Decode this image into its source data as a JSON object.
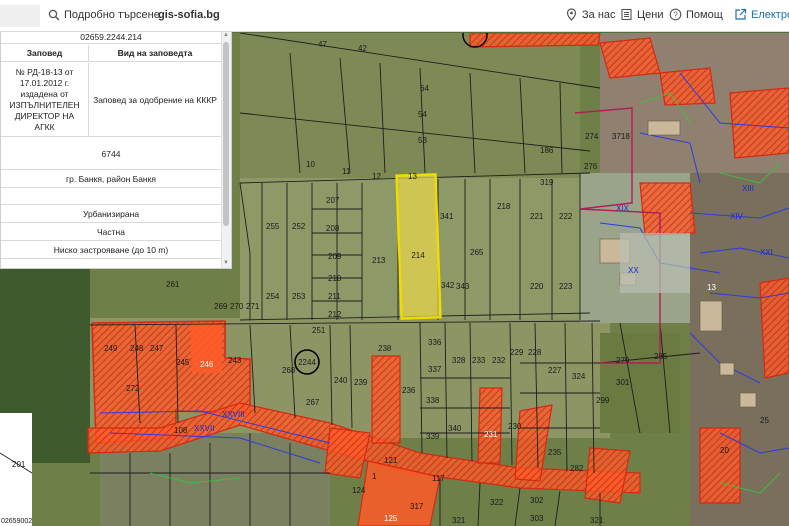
{
  "topbar": {
    "detailed_search": "Подробно търсене",
    "site_name": "gis-sofia.bg",
    "about": "За нас",
    "prices": "Цени",
    "help": "Помощ",
    "electronic": "Електрон"
  },
  "panel": {
    "parcel_id": "02659.2244.214",
    "col_order": "Заповед",
    "col_order_type": "Вид на заповедта",
    "order_text": "№ РД-18-13 от 17.01.2012 г. издадена от ИЗПЪЛНИТЕЛЕН ДИРЕКТОР НА АГКК",
    "order_type_text": "Заповед за одобрение на КККР",
    "area": "6744",
    "location": "гр. Банкя, район Банкя",
    "territory": "Урбанизирана",
    "ownership": "Частна",
    "usage": "Ниско застрояване (до 10 m)"
  },
  "map": {
    "selected_parcel": "214",
    "block_number": "2244",
    "corner_label": "02659002",
    "parcel_labels": [
      "47",
      "42",
      "53",
      "54",
      "64",
      "186",
      "274",
      "3718",
      "276",
      "10",
      "11",
      "12",
      "13",
      "319",
      "207",
      "208",
      "209",
      "210",
      "211",
      "212",
      "213",
      "341",
      "342",
      "343",
      "218",
      "221",
      "222",
      "255",
      "252",
      "254",
      "253",
      "265",
      "220",
      "223",
      "261",
      "269",
      "270",
      "271",
      "251",
      "249",
      "248",
      "247",
      "245",
      "246",
      "243",
      "272",
      "238",
      "336",
      "328",
      "233",
      "232",
      "229",
      "228",
      "279",
      "285",
      "268",
      "240",
      "239",
      "236",
      "337",
      "227",
      "324",
      "299",
      "267",
      "338",
      "230",
      "235",
      "339",
      "340",
      "231",
      "282",
      "201",
      "108",
      "117",
      "121",
      "322",
      "302",
      "303",
      "321",
      "1",
      "317",
      "321",
      "124",
      "125",
      "301",
      "XIX",
      "XIII",
      "XIV",
      "XXI",
      "XX",
      "XXVIII",
      "XXVII",
      "13",
      "25",
      "20"
    ],
    "colors": {
      "selected_fill": "#e8d64a",
      "selected_stroke": "#f2dc00",
      "regulation_fill": "#ff5a28",
      "regulation_stroke": "#e0321a",
      "parcel_line": "#1e1e1e",
      "blue_line": "#2b3ce0",
      "green_line": "#2ecc3c"
    }
  }
}
